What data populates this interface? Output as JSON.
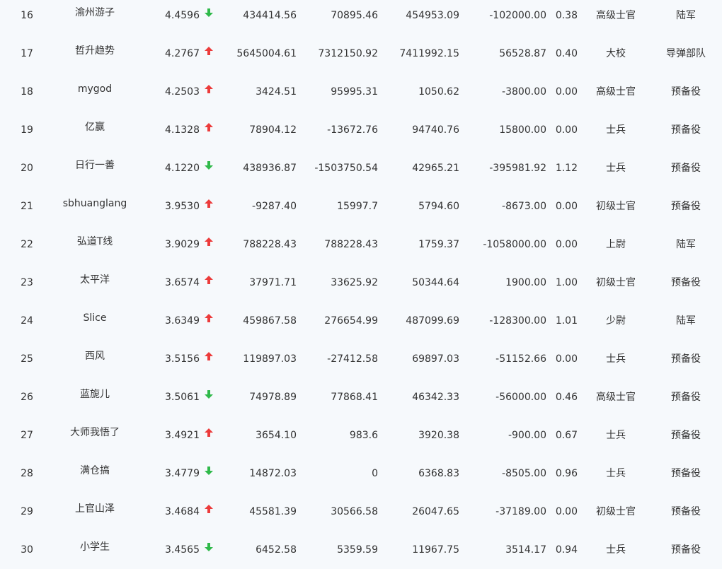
{
  "colors": {
    "up": "#ec3b3b",
    "down": "#2fb94a",
    "background": "#f6f9fc",
    "text": "#333333"
  },
  "icons": {
    "up": "arrow-up-icon",
    "down": "arrow-down-icon"
  },
  "rows": [
    {
      "rank": "16",
      "name": "渝州游子",
      "score": "4.4596",
      "trend": "down",
      "v1": "434414.56",
      "v2": "70895.46",
      "v3": "454953.09",
      "v4": "-102000.00",
      "ratio": "0.38",
      "rank_title": "高级士官",
      "branch": "陆军"
    },
    {
      "rank": "17",
      "name": "哲升趋势",
      "score": "4.2767",
      "trend": "up",
      "v1": "5645004.61",
      "v2": "7312150.92",
      "v3": "7411992.15",
      "v4": "56528.87",
      "ratio": "0.40",
      "rank_title": "大校",
      "branch": "导弹部队"
    },
    {
      "rank": "18",
      "name": "mygod",
      "score": "4.2503",
      "trend": "up",
      "v1": "3424.51",
      "v2": "95995.31",
      "v3": "1050.62",
      "v4": "-3800.00",
      "ratio": "0.00",
      "rank_title": "高级士官",
      "branch": "预备役"
    },
    {
      "rank": "19",
      "name": "亿赢",
      "score": "4.1328",
      "trend": "up",
      "v1": "78904.12",
      "v2": "-13672.76",
      "v3": "94740.76",
      "v4": "15800.00",
      "ratio": "0.00",
      "rank_title": "士兵",
      "branch": "预备役"
    },
    {
      "rank": "20",
      "name": "日行一善",
      "score": "4.1220",
      "trend": "down",
      "v1": "438936.87",
      "v2": "-1503750.54",
      "v3": "42965.21",
      "v4": "-395981.92",
      "ratio": "1.12",
      "rank_title": "士兵",
      "branch": "预备役"
    },
    {
      "rank": "21",
      "name": "sbhuanglang",
      "score": "3.9530",
      "trend": "up",
      "v1": "-9287.40",
      "v2": "15997.7",
      "v3": "5794.60",
      "v4": "-8673.00",
      "ratio": "0.00",
      "rank_title": "初级士官",
      "branch": "预备役"
    },
    {
      "rank": "22",
      "name": "弘道T线",
      "score": "3.9029",
      "trend": "up",
      "v1": "788228.43",
      "v2": "788228.43",
      "v3": "1759.37",
      "v4": "-1058000.00",
      "ratio": "0.00",
      "rank_title": "上尉",
      "branch": "陆军"
    },
    {
      "rank": "23",
      "name": "太平洋",
      "score": "3.6574",
      "trend": "up",
      "v1": "37971.71",
      "v2": "33625.92",
      "v3": "50344.64",
      "v4": "1900.00",
      "ratio": "1.00",
      "rank_title": "初级士官",
      "branch": "预备役"
    },
    {
      "rank": "24",
      "name": "Slice",
      "score": "3.6349",
      "trend": "up",
      "v1": "459867.58",
      "v2": "276654.99",
      "v3": "487099.69",
      "v4": "-128300.00",
      "ratio": "1.01",
      "rank_title": "少尉",
      "branch": "陆军"
    },
    {
      "rank": "25",
      "name": "西风",
      "score": "3.5156",
      "trend": "up",
      "v1": "119897.03",
      "v2": "-27412.58",
      "v3": "69897.03",
      "v4": "-51152.66",
      "ratio": "0.00",
      "rank_title": "士兵",
      "branch": "预备役"
    },
    {
      "rank": "26",
      "name": "蓝旎儿",
      "score": "3.5061",
      "trend": "down",
      "v1": "74978.89",
      "v2": "77868.41",
      "v3": "46342.33",
      "v4": "-56000.00",
      "ratio": "0.46",
      "rank_title": "高级士官",
      "branch": "预备役"
    },
    {
      "rank": "27",
      "name": "大师我悟了",
      "score": "3.4921",
      "trend": "up",
      "v1": "3654.10",
      "v2": "983.6",
      "v3": "3920.38",
      "v4": "-900.00",
      "ratio": "0.67",
      "rank_title": "士兵",
      "branch": "预备役"
    },
    {
      "rank": "28",
      "name": "满仓搞",
      "score": "3.4779",
      "trend": "down",
      "v1": "14872.03",
      "v2": "0",
      "v3": "6368.83",
      "v4": "-8505.00",
      "ratio": "0.96",
      "rank_title": "士兵",
      "branch": "预备役"
    },
    {
      "rank": "29",
      "name": "上官山泽",
      "score": "3.4684",
      "trend": "up",
      "v1": "45581.39",
      "v2": "30566.58",
      "v3": "26047.65",
      "v4": "-37189.00",
      "ratio": "0.00",
      "rank_title": "初级士官",
      "branch": "预备役"
    },
    {
      "rank": "30",
      "name": "小学生",
      "score": "3.4565",
      "trend": "down",
      "v1": "6452.58",
      "v2": "5359.59",
      "v3": "11967.75",
      "v4": "3514.17",
      "ratio": "0.94",
      "rank_title": "士兵",
      "branch": "预备役"
    }
  ]
}
